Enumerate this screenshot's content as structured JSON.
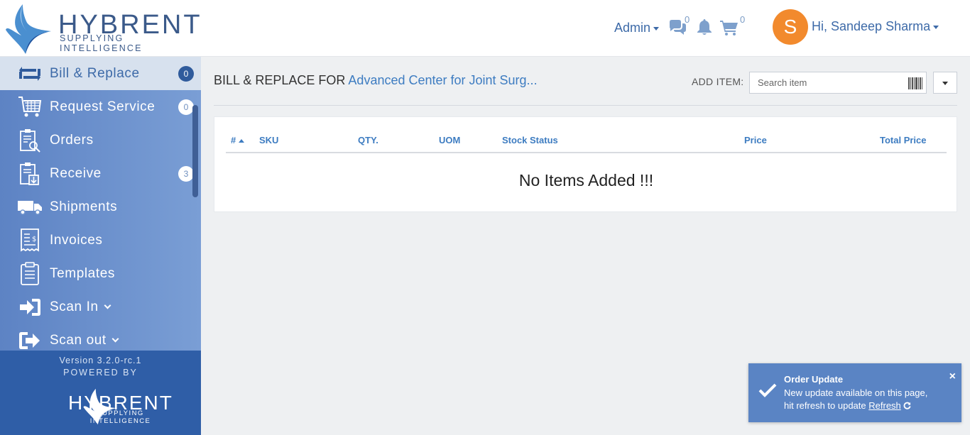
{
  "header": {
    "logo_word": "HYBRENT",
    "logo_sub": "SUPPLYING INTELLIGENCE",
    "admin_label": "Admin",
    "messages_count": "0",
    "cart_count": "0",
    "avatar_letter": "S",
    "user_greeting": "Hi, Sandeep Sharma"
  },
  "sidebar": {
    "items": [
      {
        "label": "Bill & Replace",
        "badge": "0",
        "icon": "bill-replace-icon"
      },
      {
        "label": "Request Service",
        "badge": "0",
        "icon": "request-service-icon"
      },
      {
        "label": "Orders",
        "icon": "orders-icon"
      },
      {
        "label": "Receive",
        "badge": "3",
        "icon": "receive-icon"
      },
      {
        "label": "Shipments",
        "icon": "truck-icon"
      },
      {
        "label": "Invoices",
        "icon": "invoice-icon"
      },
      {
        "label": "Templates",
        "icon": "clipboard-icon"
      },
      {
        "label": "Scan In",
        "icon": "scan-in-icon"
      },
      {
        "label": "Scan out",
        "icon": "scan-out-icon"
      }
    ],
    "version": "Version 3.2.0-rc.1",
    "powered_by": "POWERED BY",
    "footer_logo_word": "HYBRENT",
    "footer_logo_sub": "SUPPLYING INTELLIGENCE"
  },
  "main": {
    "title_prefix": "BILL & REPLACE FOR",
    "title_highlight": "Advanced Center for Joint Surg...",
    "add_item_label": "ADD ITEM:",
    "search_placeholder": "Search item",
    "table": {
      "columns": [
        "#",
        "SKU",
        "QTY.",
        "UOM",
        "Stock Status",
        "Price",
        "Total Price"
      ],
      "empty_message": "No Items Added !!!"
    }
  },
  "toast": {
    "title": "Order Update",
    "line1": "New update available on this page,",
    "line2_prefix": "hit refresh to update",
    "link": "Refresh",
    "close": "×"
  },
  "colors": {
    "brand_blue": "#3d6aa8",
    "sidebar_bg": "#7296cf",
    "sidebar_footer": "#2f5ea7",
    "avatar": "#f28a2d",
    "toast_bg": "#5a84c4"
  }
}
